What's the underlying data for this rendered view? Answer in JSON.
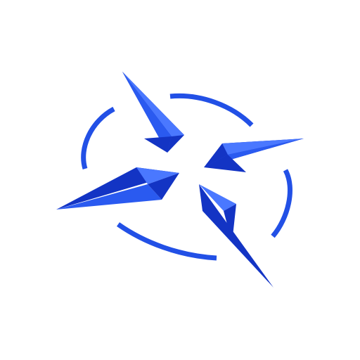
{
  "logo": {
    "icon": "compass-star-icon",
    "colors": {
      "background": "#ffffff",
      "primary": "#2250e6",
      "dark": "#1334c4",
      "mid": "#2a5af0",
      "light": "#4a78ff"
    }
  }
}
